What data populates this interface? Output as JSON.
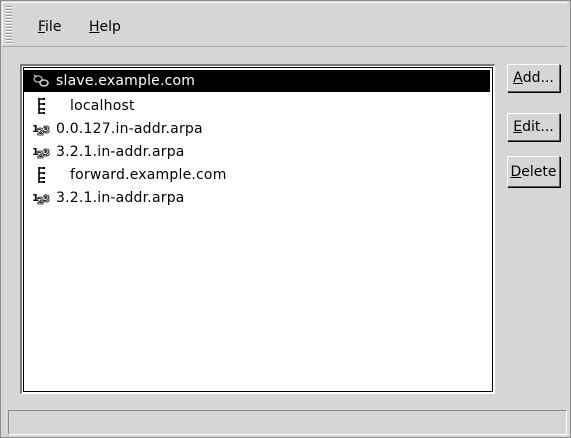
{
  "menubar": {
    "items": [
      {
        "accel": "F",
        "rest": "ile"
      },
      {
        "accel": "H",
        "rest": "elp"
      }
    ]
  },
  "zones": [
    {
      "label": "slave.example.com",
      "icon": "slave-zone-icon",
      "selected": true
    },
    {
      "label": "localhost",
      "icon": "forward-zone-icon",
      "selected": false
    },
    {
      "label": "0.0.127.in-addr.arpa",
      "icon": "reverse-zone-icon",
      "selected": false
    },
    {
      "label": "3.2.1.in-addr.arpa",
      "icon": "reverse-zone-icon",
      "selected": false
    },
    {
      "label": "forward.example.com",
      "icon": "forward-zone-icon",
      "selected": false
    },
    {
      "label": "3.2.1.in-addr.arpa",
      "icon": "reverse-zone-icon",
      "selected": false
    }
  ],
  "buttons": {
    "add": {
      "accel": "A",
      "rest": "dd..."
    },
    "edit": {
      "accel": "E",
      "rest": "dit..."
    },
    "delete": {
      "accel": "D",
      "rest": "elete"
    }
  },
  "statusbar": {
    "text": ""
  },
  "colors": {
    "selection_bg": "#000000",
    "selection_fg": "#ffffff",
    "window_bg": "#d6d6d6"
  }
}
